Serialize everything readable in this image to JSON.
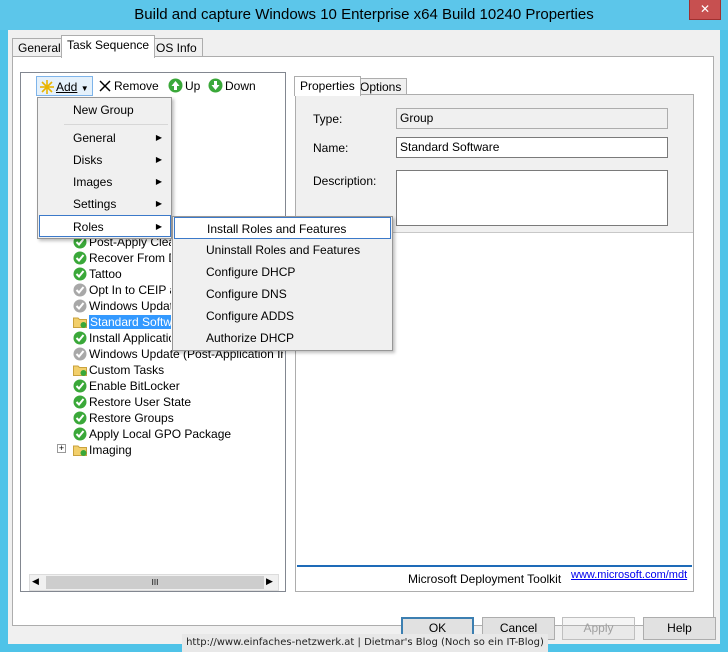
{
  "window": {
    "title": "Build and capture Windows 10 Enterprise x64 Build 10240 Properties",
    "close_label": "✕"
  },
  "tabs": [
    {
      "label": "General"
    },
    {
      "label": "Task Sequence"
    },
    {
      "label": "OS Info"
    }
  ],
  "toolbar": {
    "add": "Add",
    "remove": "Remove",
    "up": "Up",
    "down": "Down"
  },
  "tree": {
    "items": [
      {
        "label": "Post-Apply Cleanu",
        "status": "ok"
      },
      {
        "label": "Recover From Do",
        "status": "ok"
      },
      {
        "label": "Tattoo",
        "status": "ok"
      },
      {
        "label": "Opt In to CEIP an",
        "status": "disabled"
      },
      {
        "label": "Windows Update",
        "status": "disabled"
      },
      {
        "label": "Standard Softwar",
        "status": "folder"
      },
      {
        "label": "Install Application",
        "status": "ok"
      },
      {
        "label": "Windows Update (Post-Application Install",
        "status": "disabled"
      },
      {
        "label": "Custom Tasks",
        "status": "folder"
      },
      {
        "label": "Enable BitLocker",
        "status": "ok"
      },
      {
        "label": "Restore User State",
        "status": "ok"
      },
      {
        "label": "Restore Groups",
        "status": "ok"
      },
      {
        "label": "Apply Local GPO Package",
        "status": "ok"
      },
      {
        "label": "Imaging",
        "status": "folder"
      }
    ],
    "expander": "+"
  },
  "add_menu": {
    "items": [
      {
        "label": "New Group",
        "submenu": false
      },
      {
        "label": "General",
        "submenu": true
      },
      {
        "label": "Disks",
        "submenu": true
      },
      {
        "label": "Images",
        "submenu": true
      },
      {
        "label": "Settings",
        "submenu": true
      },
      {
        "label": "Roles",
        "submenu": true
      }
    ],
    "arrow": "▶"
  },
  "roles_menu": {
    "items": [
      {
        "label": "Install Roles and Features"
      },
      {
        "label": "Uninstall Roles and Features"
      },
      {
        "label": "Configure DHCP"
      },
      {
        "label": "Configure DNS"
      },
      {
        "label": "Configure ADDS"
      },
      {
        "label": "Authorize DHCP"
      }
    ]
  },
  "props": {
    "tabs": [
      {
        "label": "Properties"
      },
      {
        "label": "Options"
      }
    ],
    "type_label": "Type:",
    "type_value": "Group",
    "name_label": "Name:",
    "name_value": "Standard Software",
    "description_label": "Description:",
    "description_value": "",
    "footer_text": "Microsoft Deployment Toolkit",
    "footer_link": "www.microsoft.com/mdt"
  },
  "buttons": {
    "ok": "OK",
    "cancel": "Cancel",
    "apply": "Apply",
    "help": "Help"
  },
  "watermark": "http://www.einfaches-netzwerk.at | Dietmar's Blog (Noch so ein IT-Blog)",
  "scroll_grip": "III"
}
